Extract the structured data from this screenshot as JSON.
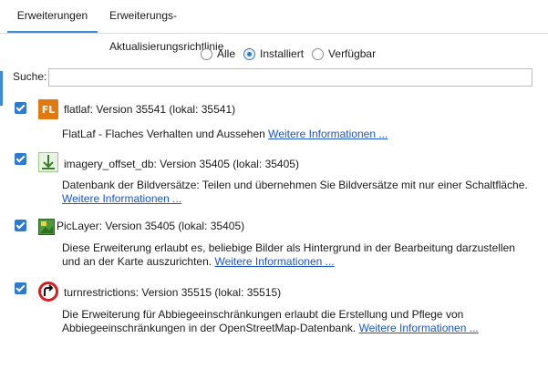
{
  "tabs": [
    {
      "label": "Erweiterungen",
      "active": true
    },
    {
      "label": "Erweiterungs-Aktualisierungsrichtlinie",
      "active": false
    }
  ],
  "filter": {
    "options": [
      {
        "label": "Alle",
        "checked": false
      },
      {
        "label": "Installiert",
        "checked": true
      },
      {
        "label": "Verfügbar",
        "checked": false
      }
    ]
  },
  "search": {
    "label": "Suche:",
    "value": ""
  },
  "plugins": [
    {
      "title": "flatlaf: Version 35541 (lokal: 35541)",
      "description": "FlatLaf - Flaches Verhalten und Aussehen",
      "more": "Weitere Informationen ...",
      "checked": true,
      "icon": "flatlaf-icon",
      "icon_text": "FL"
    },
    {
      "title": "imagery_offset_db: Version 35405 (lokal: 35405)",
      "description": "Datenbank der Bildversätze: Teilen und übernehmen Sie Bildversätze mit nur einer Schaltfläche.",
      "more": "Weitere Informationen ...",
      "checked": true,
      "icon": "imagery-offset-icon"
    },
    {
      "title": "PicLayer: Version 35405 (lokal: 35405)",
      "description": "Diese Erweiterung erlaubt es, beliebige Bilder als Hintergrund in der Bearbeitung darzustellen und an der Karte auszurichten.",
      "more": "Weitere Informationen ...",
      "checked": true,
      "icon": "piclayer-icon"
    },
    {
      "title": "turnrestrictions: Version 35515 (lokal: 35515)",
      "description": "Die Erweiterung für Abbiegeeinschränkungen erlaubt die Erstellung und Pflege von Abbiegeeinschränkungen in der OpenStreetMap-Datenbank.",
      "more": "Weitere Informationen ...",
      "checked": true,
      "icon": "turn-restriction-icon"
    }
  ]
}
